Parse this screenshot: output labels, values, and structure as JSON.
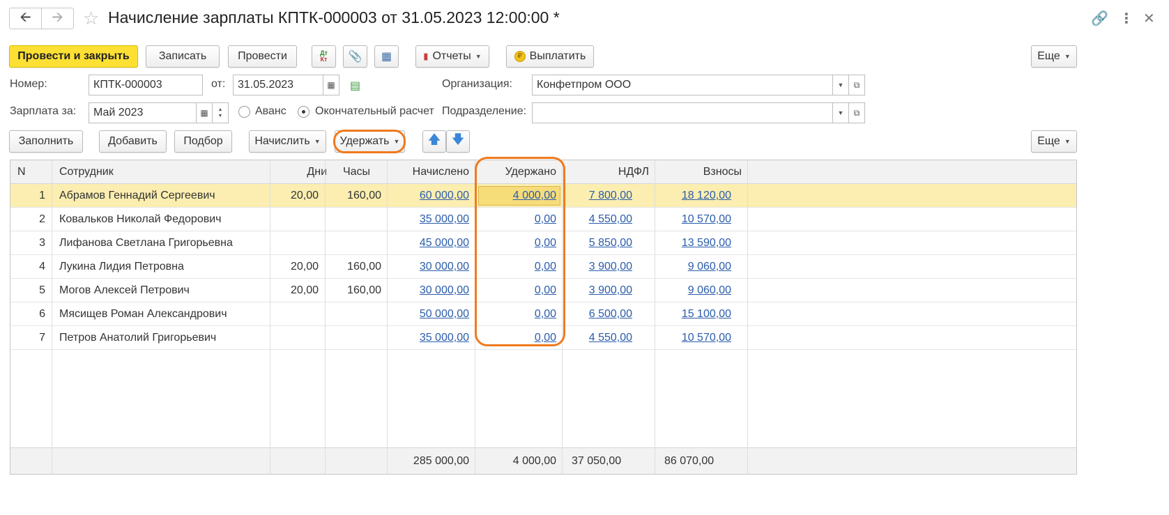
{
  "window": {
    "back_icon": "arrow-left-icon",
    "forward_icon": "arrow-right-icon",
    "title": "Начисление зарплаты КПТК-000003 от 31.05.2023 12:00:00 *"
  },
  "toolbar": {
    "post_close": "Провести и закрыть",
    "save": "Записать",
    "post": "Провести",
    "dt_kt": "Дт\nКт",
    "reports": "Отчеты",
    "pay": "Выплатить",
    "more": "Еще"
  },
  "form": {
    "number_label": "Номер:",
    "number_value": "КПТК-000003",
    "date_label": "от:",
    "date_value": "31.05.2023",
    "org_label": "Организация:",
    "org_value": "Конфетпром ООО",
    "salary_for_label": "Зарплата за:",
    "salary_for_value": "Май 2023",
    "advance_label": "Аванс",
    "final_label": "Окончательный расчет",
    "dept_label": "Подразделение:",
    "dept_value": ""
  },
  "table_toolbar": {
    "fill": "Заполнить",
    "add": "Добавить",
    "pick": "Подбор",
    "accrue": "Начислить",
    "withhold": "Удержать",
    "more": "Еще"
  },
  "table": {
    "columns": [
      "N",
      "Сотрудник",
      "Дни",
      "Часы",
      "Начислено",
      "Удержано",
      "НДФЛ",
      "Взносы"
    ],
    "rows": [
      {
        "n": "1",
        "employee": "Абрамов Геннадий Сергеевич",
        "days": "20,00",
        "hours": "160,00",
        "accrued": "60 000,00",
        "withheld": "4 000,00",
        "ndfl": "7 800,00",
        "contrib": "18 120,00"
      },
      {
        "n": "2",
        "employee": "Ковальков Николай Федорович",
        "days": "",
        "hours": "",
        "accrued": "35 000,00",
        "withheld": "0,00",
        "ndfl": "4 550,00",
        "contrib": "10 570,00"
      },
      {
        "n": "3",
        "employee": "Лифанова Светлана Григорьевна",
        "days": "",
        "hours": "",
        "accrued": "45 000,00",
        "withheld": "0,00",
        "ndfl": "5 850,00",
        "contrib": "13 590,00"
      },
      {
        "n": "4",
        "employee": "Лукина Лидия Петровна",
        "days": "20,00",
        "hours": "160,00",
        "accrued": "30 000,00",
        "withheld": "0,00",
        "ndfl": "3 900,00",
        "contrib": "9 060,00"
      },
      {
        "n": "5",
        "employee": "Могов Алексей Петрович",
        "days": "20,00",
        "hours": "160,00",
        "accrued": "30 000,00",
        "withheld": "0,00",
        "ndfl": "3 900,00",
        "contrib": "9 060,00"
      },
      {
        "n": "6",
        "employee": "Мясищев Роман Александрович",
        "days": "",
        "hours": "",
        "accrued": "50 000,00",
        "withheld": "0,00",
        "ndfl": "6 500,00",
        "contrib": "15 100,00"
      },
      {
        "n": "7",
        "employee": "Петров Анатолий Григорьевич",
        "days": "",
        "hours": "",
        "accrued": "35 000,00",
        "withheld": "0,00",
        "ndfl": "4 550,00",
        "contrib": "10 570,00"
      }
    ],
    "totals": {
      "accrued": "285 000,00",
      "withheld": "4 000,00",
      "ndfl": "37 050,00",
      "contrib": "86 070,00"
    }
  },
  "colors": {
    "primary_button": "#fde033",
    "selected_row": "#fbeeb0",
    "highlight": "#f07a1e",
    "link": "#2a5caa"
  }
}
